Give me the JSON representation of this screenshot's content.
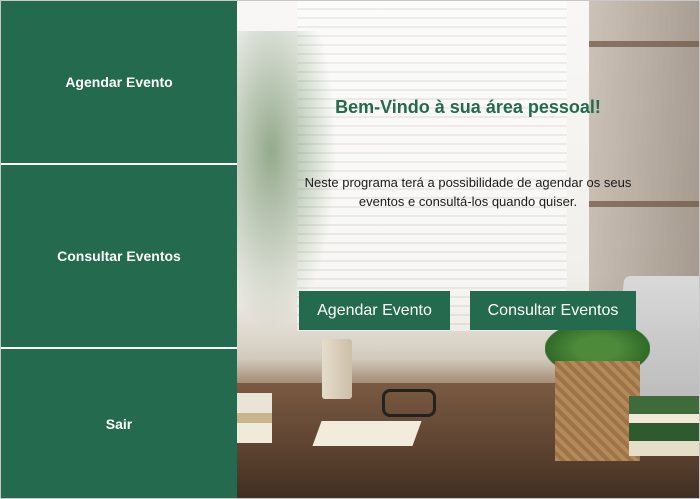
{
  "sidebar": {
    "items": [
      {
        "label": "Agendar Evento"
      },
      {
        "label": "Consultar Eventos"
      },
      {
        "label": "Sair"
      }
    ]
  },
  "main": {
    "title": "Bem-Vindo à sua área pessoal!",
    "description": "Neste programa terá a possibilidade de agendar os seus eventos e consultá-los quando quiser.",
    "buttons": {
      "schedule_label": "Agendar Evento",
      "consult_label": "Consultar Eventos"
    }
  },
  "colors": {
    "accent": "#236a4e",
    "button_text": "#ffffff"
  }
}
